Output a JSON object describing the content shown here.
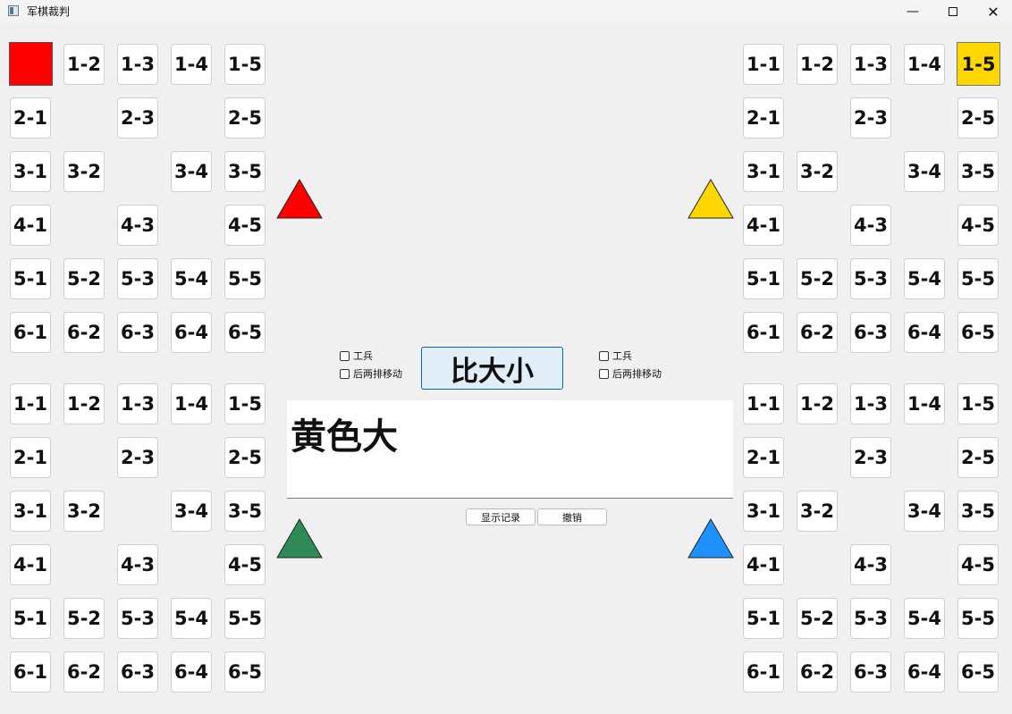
{
  "window": {
    "title": "军棋裁判",
    "minimize_icon": "minimize-icon",
    "maximize_icon": "maximize-icon",
    "close_icon": "close-icon"
  },
  "colors": {
    "red": "#ff0000",
    "gold": "#ffd700",
    "green": "#2e8b57",
    "blue": "#1e90ff"
  },
  "boards": {
    "top_left": [
      [
        "",
        "1-2",
        "1-3",
        "1-4",
        "1-5"
      ],
      [
        "2-1",
        "",
        "2-3",
        "",
        "2-5"
      ],
      [
        "3-1",
        "3-2",
        "",
        "3-4",
        "3-5"
      ],
      [
        "4-1",
        "",
        "4-3",
        "",
        "4-5"
      ],
      [
        "5-1",
        "5-2",
        "5-3",
        "5-4",
        "5-5"
      ],
      [
        "6-1",
        "6-2",
        "6-3",
        "6-4",
        "6-5"
      ]
    ],
    "top_right": [
      [
        "1-1",
        "1-2",
        "1-3",
        "1-4",
        "1-5"
      ],
      [
        "2-1",
        "",
        "2-3",
        "",
        "2-5"
      ],
      [
        "3-1",
        "3-2",
        "",
        "3-4",
        "3-5"
      ],
      [
        "4-1",
        "",
        "4-3",
        "",
        "4-5"
      ],
      [
        "5-1",
        "5-2",
        "5-3",
        "5-4",
        "5-5"
      ],
      [
        "6-1",
        "6-2",
        "6-3",
        "6-4",
        "6-5"
      ]
    ],
    "bottom_left": [
      [
        "1-1",
        "1-2",
        "1-3",
        "1-4",
        "1-5"
      ],
      [
        "2-1",
        "",
        "2-3",
        "",
        "2-5"
      ],
      [
        "3-1",
        "3-2",
        "",
        "3-4",
        "3-5"
      ],
      [
        "4-1",
        "",
        "4-3",
        "",
        "4-5"
      ],
      [
        "5-1",
        "5-2",
        "5-3",
        "5-4",
        "5-5"
      ],
      [
        "6-1",
        "6-2",
        "6-3",
        "6-4",
        "6-5"
      ]
    ],
    "bottom_right": [
      [
        "1-1",
        "1-2",
        "1-3",
        "1-4",
        "1-5"
      ],
      [
        "2-1",
        "",
        "2-3",
        "",
        "2-5"
      ],
      [
        "3-1",
        "3-2",
        "",
        "3-4",
        "3-5"
      ],
      [
        "4-1",
        "",
        "4-3",
        "",
        "4-5"
      ],
      [
        "5-1",
        "5-2",
        "5-3",
        "5-4",
        "5-5"
      ],
      [
        "6-1",
        "6-2",
        "6-3",
        "6-4",
        "6-5"
      ]
    ],
    "top_left_marked": "1-1",
    "top_right_selected": "1-5"
  },
  "controls": {
    "left_engineer_label": "工兵",
    "left_back_rows_label": "后两排移动",
    "right_engineer_label": "工兵",
    "right_back_rows_label": "后两排移动",
    "compare_label": "比大小",
    "result_text": "黄色大",
    "show_record_label": "显示记录",
    "undo_label": "撤销"
  }
}
